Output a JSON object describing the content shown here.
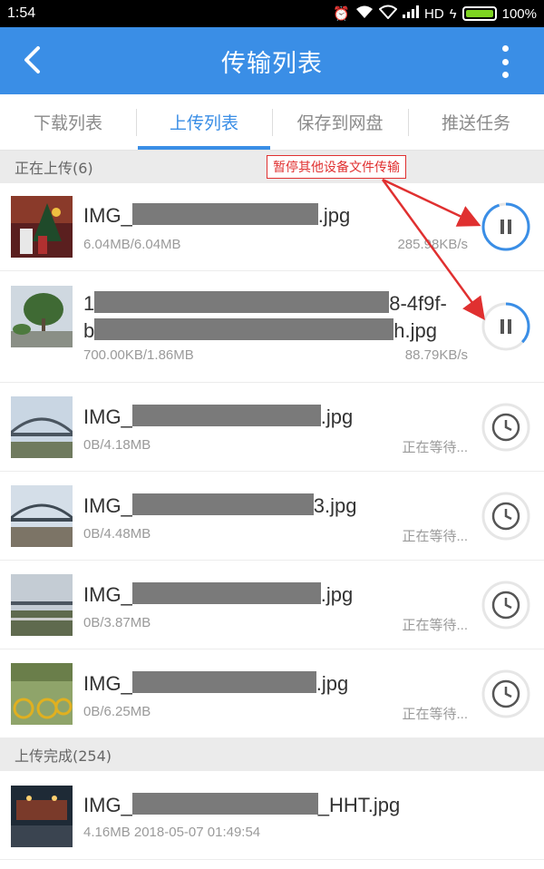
{
  "status_bar": {
    "time": "1:54",
    "network": "HD",
    "battery": "100%"
  },
  "app_bar": {
    "title": "传输列表"
  },
  "tabs": [
    {
      "label": "下载列表"
    },
    {
      "label": "上传列表"
    },
    {
      "label": "保存到网盘"
    },
    {
      "label": "推送任务"
    }
  ],
  "uploading": {
    "header": "正在上传(6)",
    "items": [
      {
        "name_start": "IMG_",
        "name_end": ".jpg",
        "size": "6.04MB/6.04MB",
        "status": "285.98KB/s",
        "progress": 0.95,
        "action": "pause-icon"
      },
      {
        "name_start": "1",
        "name_mid": "8-4f9f-",
        "name_line2_start": "b",
        "name_end": "h.jpg",
        "size": "700.00KB/1.86MB",
        "status": "88.79KB/s",
        "progress": 0.37,
        "action": "pause-icon"
      },
      {
        "name_start": "IMG_",
        "name_end": ".jpg",
        "size": "0B/4.18MB",
        "status": "正在等待...",
        "action": "clock-icon"
      },
      {
        "name_start": "IMG_",
        "name_end": "3.jpg",
        "size": "0B/4.48MB",
        "status": "正在等待...",
        "action": "clock-icon"
      },
      {
        "name_start": "IMG_",
        "name_end": ".jpg",
        "size": "0B/3.87MB",
        "status": "正在等待...",
        "action": "clock-icon"
      },
      {
        "name_start": "IMG_",
        "name_end": ".jpg",
        "size": "0B/6.25MB",
        "status": "正在等待...",
        "action": "clock-icon"
      }
    ]
  },
  "completed": {
    "header": "上传完成(254)",
    "items": [
      {
        "name_start": "IMG_",
        "name_end": "_HHT.jpg",
        "meta": "4.16MB 2018-05-07 01:49:54"
      }
    ]
  },
  "annotation": {
    "text": "暂停其他设备文件传输"
  },
  "colors": {
    "accent": "#3a8ee6",
    "annotation": "#e03030",
    "redaction": "#7a7a7a"
  }
}
